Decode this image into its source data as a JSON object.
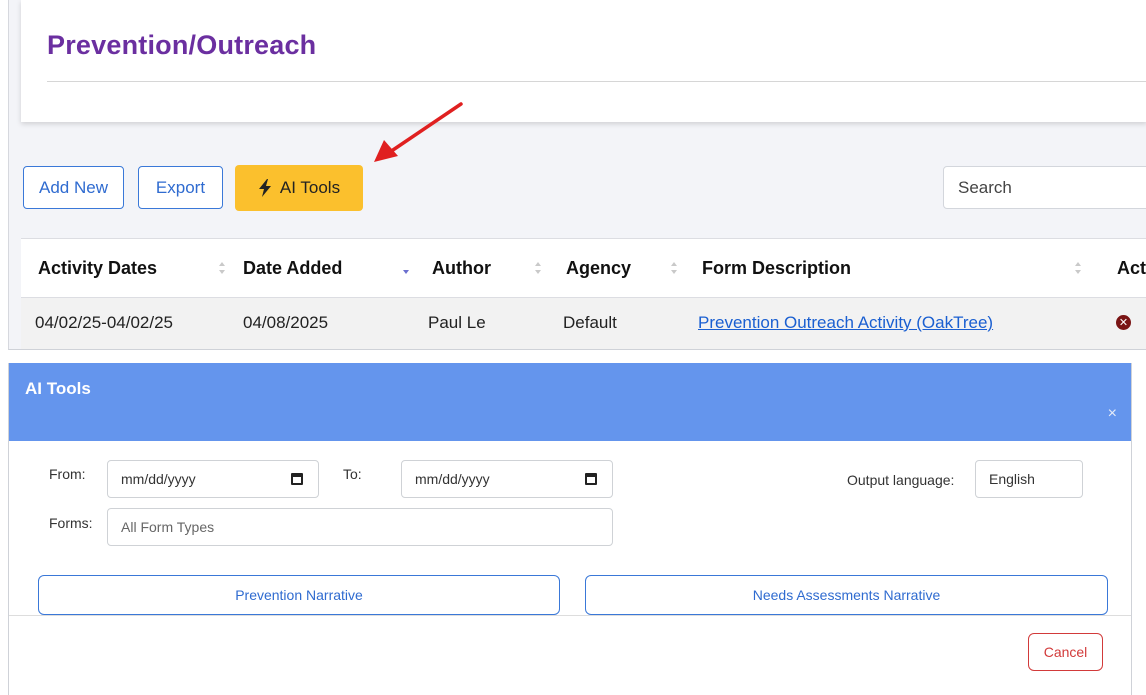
{
  "page": {
    "title": "Prevention/Outreach"
  },
  "toolbar": {
    "add_new_label": "Add New",
    "export_label": "Export",
    "ai_tools_label": "AI Tools",
    "search_placeholder": "Search"
  },
  "table": {
    "columns": [
      "Activity Dates",
      "Date Added",
      "Author",
      "Agency",
      "Form Description",
      "Acti"
    ],
    "rows": [
      {
        "activity_dates": "04/02/25-04/02/25",
        "date_added": "04/08/2025",
        "author": "Paul Le",
        "agency": "Default",
        "form_description": "Prevention Outreach Activity (OakTree)"
      }
    ]
  },
  "dialog": {
    "title": "AI Tools",
    "close_glyph": "×",
    "from_label": "From:",
    "from_value": "mm/dd/yyyy",
    "to_label": "To:",
    "to_value": "mm/dd/yyyy",
    "output_language_label": "Output language:",
    "output_language_value": "English",
    "forms_label": "Forms:",
    "forms_placeholder": "All Form Types",
    "prevention_narrative_label": "Prevention Narrative",
    "needs_assessments_label": "Needs Assessments Narrative",
    "cancel_label": "Cancel"
  },
  "colors": {
    "title_purple": "#6b2fa0",
    "ai_button_yellow": "#fbc02d",
    "dialog_header_blue": "#6495ed",
    "link_blue": "#1a5fd1",
    "cancel_red": "#d23a3a",
    "annotation_arrow_red": "#e02020"
  }
}
